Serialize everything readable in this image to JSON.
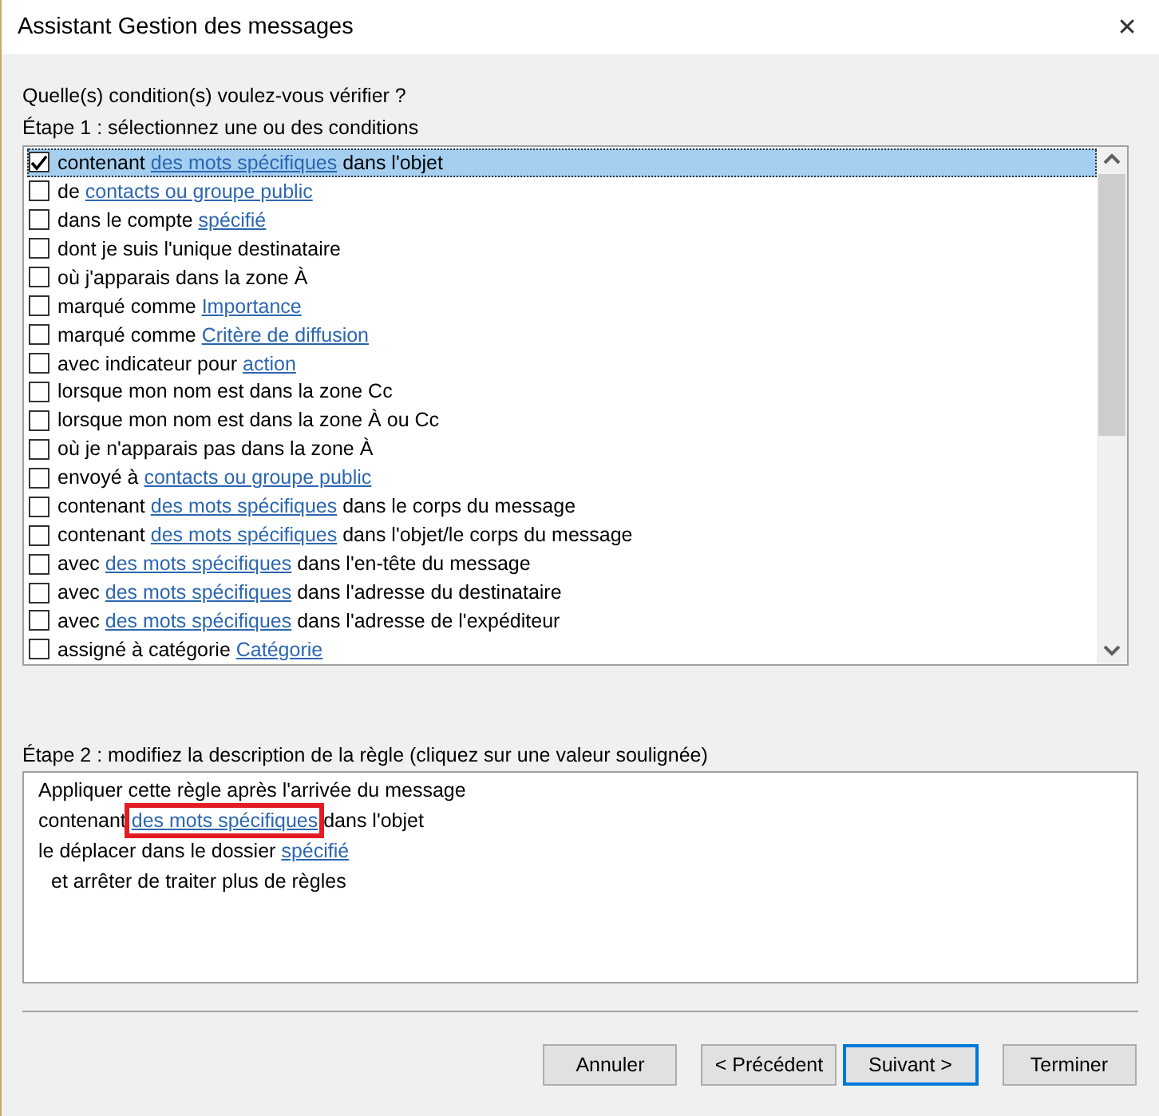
{
  "window": {
    "title": "Assistant Gestion des messages",
    "close": "✕"
  },
  "question": "Quelle(s) condition(s) voulez-vous vérifier ?",
  "step1": {
    "label": "Étape 1 : sélectionnez une ou des conditions",
    "conditions": [
      {
        "checked": true,
        "selected": true,
        "parts": [
          {
            "text": "contenant ",
            "link": false
          },
          {
            "text": "des mots spécifiques",
            "link": true
          },
          {
            "text": " dans l'objet",
            "link": false
          }
        ]
      },
      {
        "checked": false,
        "selected": false,
        "parts": [
          {
            "text": "de ",
            "link": false
          },
          {
            "text": "contacts ou groupe public",
            "link": true
          }
        ]
      },
      {
        "checked": false,
        "selected": false,
        "parts": [
          {
            "text": "dans le compte ",
            "link": false
          },
          {
            "text": "spécifié",
            "link": true
          }
        ]
      },
      {
        "checked": false,
        "selected": false,
        "parts": [
          {
            "text": "dont je suis l'unique destinataire",
            "link": false
          }
        ]
      },
      {
        "checked": false,
        "selected": false,
        "parts": [
          {
            "text": "où j'apparais dans la zone À",
            "link": false
          }
        ]
      },
      {
        "checked": false,
        "selected": false,
        "parts": [
          {
            "text": "marqué comme ",
            "link": false
          },
          {
            "text": "Importance",
            "link": true
          }
        ]
      },
      {
        "checked": false,
        "selected": false,
        "parts": [
          {
            "text": "marqué comme ",
            "link": false
          },
          {
            "text": "Critère de diffusion",
            "link": true
          }
        ]
      },
      {
        "checked": false,
        "selected": false,
        "parts": [
          {
            "text": "avec indicateur pour ",
            "link": false
          },
          {
            "text": "action ",
            "link": true
          }
        ]
      },
      {
        "checked": false,
        "selected": false,
        "parts": [
          {
            "text": "lorsque mon nom est dans la zone Cc",
            "link": false
          }
        ]
      },
      {
        "checked": false,
        "selected": false,
        "parts": [
          {
            "text": "lorsque mon nom est dans la zone À ou Cc",
            "link": false
          }
        ]
      },
      {
        "checked": false,
        "selected": false,
        "parts": [
          {
            "text": "où je n'apparais pas dans la zone À",
            "link": false
          }
        ]
      },
      {
        "checked": false,
        "selected": false,
        "parts": [
          {
            "text": "envoyé à ",
            "link": false
          },
          {
            "text": "contacts ou groupe public",
            "link": true
          }
        ]
      },
      {
        "checked": false,
        "selected": false,
        "parts": [
          {
            "text": "contenant ",
            "link": false
          },
          {
            "text": "des mots spécifiques",
            "link": true
          },
          {
            "text": " dans le corps du message",
            "link": false
          }
        ]
      },
      {
        "checked": false,
        "selected": false,
        "parts": [
          {
            "text": "contenant ",
            "link": false
          },
          {
            "text": "des mots spécifiques",
            "link": true
          },
          {
            "text": " dans l'objet/le corps du message",
            "link": false
          }
        ]
      },
      {
        "checked": false,
        "selected": false,
        "parts": [
          {
            "text": "avec ",
            "link": false
          },
          {
            "text": "des mots spécifiques",
            "link": true
          },
          {
            "text": " dans l'en-tête du message",
            "link": false
          }
        ]
      },
      {
        "checked": false,
        "selected": false,
        "parts": [
          {
            "text": "avec ",
            "link": false
          },
          {
            "text": "des mots spécifiques",
            "link": true
          },
          {
            "text": " dans l'adresse du destinataire",
            "link": false
          }
        ]
      },
      {
        "checked": false,
        "selected": false,
        "parts": [
          {
            "text": "avec ",
            "link": false
          },
          {
            "text": "des mots spécifiques",
            "link": true
          },
          {
            "text": " dans l'adresse de l'expéditeur",
            "link": false
          }
        ]
      },
      {
        "checked": false,
        "selected": false,
        "parts": [
          {
            "text": "assigné à catégorie ",
            "link": false
          },
          {
            "text": "Catégorie",
            "link": true
          }
        ]
      }
    ]
  },
  "step2": {
    "label": "Étape 2 : modifiez la description de la règle (cliquez sur une valeur soulignée)",
    "lines": [
      {
        "indented": false,
        "parts": [
          {
            "text": "Appliquer cette règle après l'arrivée du message",
            "link": false
          }
        ]
      },
      {
        "indented": false,
        "parts": [
          {
            "text": "contenant ",
            "link": false,
            "highlighted": false
          },
          {
            "text": "des mots spécifiques",
            "link": true,
            "highlighted": true
          },
          {
            "text": " dans l'objet",
            "link": false,
            "highlighted": false
          }
        ]
      },
      {
        "indented": false,
        "parts": [
          {
            "text": "le déplacer dans le dossier ",
            "link": false,
            "highlighted": false
          },
          {
            "text": "spécifié",
            "link": true,
            "highlighted": false
          }
        ]
      },
      {
        "indented": true,
        "parts": [
          {
            "text": "et arrêter de traiter plus de règles",
            "link": false
          }
        ]
      }
    ]
  },
  "buttons": [
    {
      "label": "Annuler",
      "focused": false
    },
    {
      "label": "< Précédent",
      "focused": false
    },
    {
      "label": "Suivant >",
      "focused": true
    },
    {
      "label": "Terminer",
      "focused": false
    }
  ]
}
